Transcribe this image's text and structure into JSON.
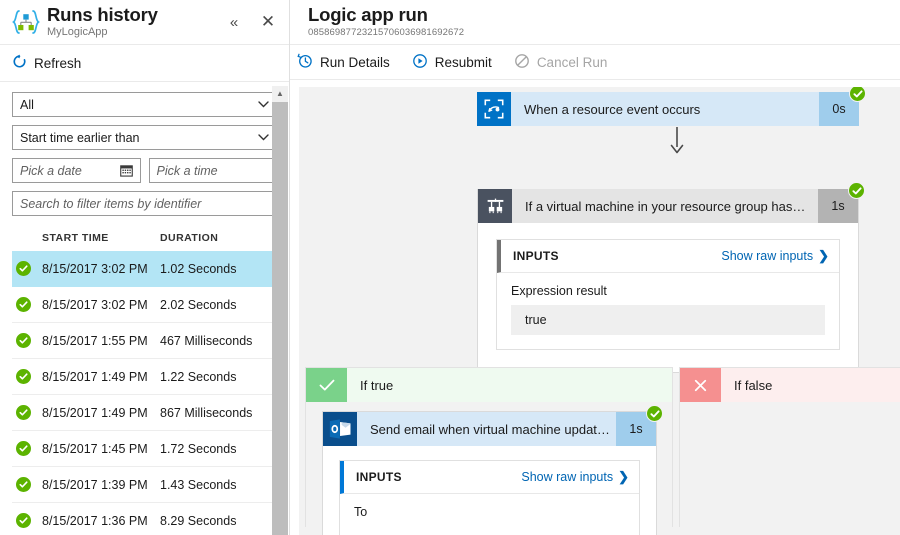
{
  "left_panel": {
    "logo_icon": "logic-apps-icon",
    "title": "Runs history",
    "subtitle": "MyLogicApp",
    "collapse_icon": "«",
    "close_icon": "✕",
    "toolbar": {
      "refresh_label": "Refresh",
      "refresh_icon": "refresh-icon"
    },
    "filters": {
      "status_value": "All",
      "time_filter_value": "Start time earlier than",
      "date_placeholder": "Pick a date",
      "time_placeholder": "Pick a time",
      "search_placeholder": "Search to filter items by identifier",
      "chevron_icon": "⌄"
    },
    "columns": [
      "START TIME",
      "DURATION"
    ],
    "runs": [
      {
        "status": "succeeded",
        "start_time": "8/15/2017 3:02 PM",
        "duration": "1.02 Seconds",
        "selected": true
      },
      {
        "status": "succeeded",
        "start_time": "8/15/2017 3:02 PM",
        "duration": "2.02 Seconds",
        "selected": false
      },
      {
        "status": "succeeded",
        "start_time": "8/15/2017 1:55 PM",
        "duration": "467 Milliseconds",
        "selected": false
      },
      {
        "status": "succeeded",
        "start_time": "8/15/2017 1:49 PM",
        "duration": "1.22 Seconds",
        "selected": false
      },
      {
        "status": "succeeded",
        "start_time": "8/15/2017 1:49 PM",
        "duration": "867 Milliseconds",
        "selected": false
      },
      {
        "status": "succeeded",
        "start_time": "8/15/2017 1:45 PM",
        "duration": "1.72 Seconds",
        "selected": false
      },
      {
        "status": "succeeded",
        "start_time": "8/15/2017 1:39 PM",
        "duration": "1.43 Seconds",
        "selected": false
      },
      {
        "status": "succeeded",
        "start_time": "8/15/2017 1:36 PM",
        "duration": "8.29 Seconds",
        "selected": false
      }
    ]
  },
  "right_panel": {
    "title": "Logic app run",
    "run_id": "08586987723215706036981692672",
    "toolbar": [
      {
        "label": "Run Details",
        "icon": "history-clock-icon",
        "disabled": false
      },
      {
        "label": "Resubmit",
        "icon": "play-circle-icon",
        "disabled": false
      },
      {
        "label": "Cancel Run",
        "icon": "cancel-circle-icon",
        "disabled": true
      }
    ],
    "flow": {
      "trigger": {
        "name": "When a resource event occurs",
        "duration": "0s",
        "icon": "event-grid-icon",
        "status": "succeeded"
      },
      "condition": {
        "name": "If a virtual machine in your resource group has…",
        "duration": "1s",
        "icon": "condition-icon",
        "status": "succeeded",
        "inputs": {
          "header": "INPUTS",
          "show_raw_label": "Show raw inputs",
          "field_label": "Expression result",
          "field_value": "true"
        }
      },
      "branch_true": {
        "label": "If true",
        "icon": "check-icon",
        "action": {
          "name": "Send email when virtual machine updat…",
          "duration": "1s",
          "icon": "outlook-icon",
          "status": "succeeded",
          "inputs": {
            "header": "INPUTS",
            "show_raw_label": "Show raw inputs",
            "field_label": "To"
          }
        }
      },
      "branch_false": {
        "label": "If false",
        "icon": "x-icon"
      }
    }
  },
  "colors": {
    "accent_blue": "#0072c6",
    "link_blue": "#0065b3",
    "success_green": "#5cb300",
    "selected_row": "#b3e5f5",
    "true_branch": "#7ad28a",
    "false_branch": "#f59090",
    "canvas_bg": "#f2f2f2"
  }
}
